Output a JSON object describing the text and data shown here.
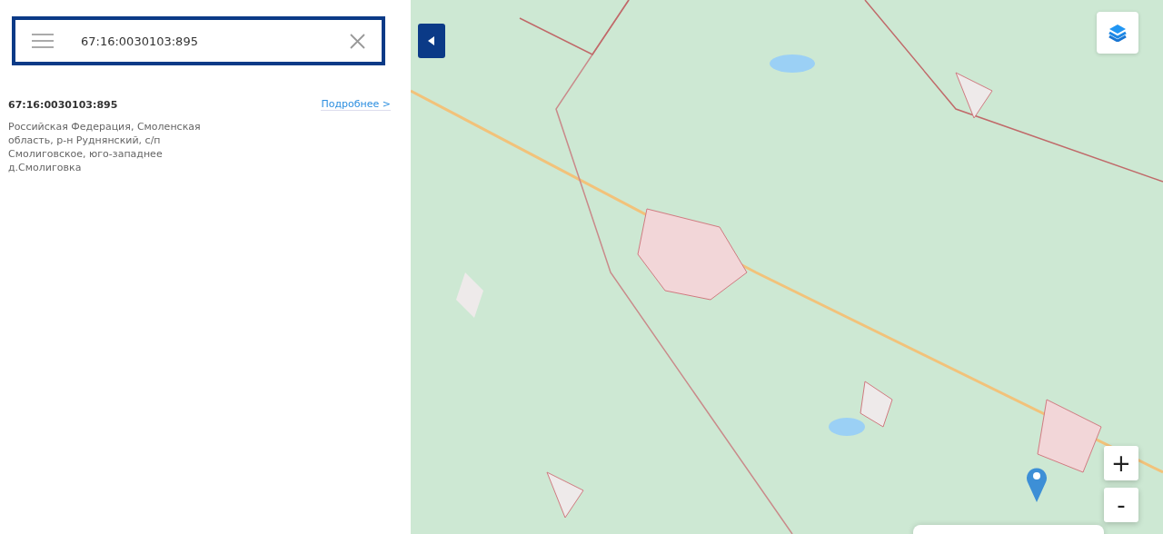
{
  "search": {
    "value": "67:16:0030103:895"
  },
  "result": {
    "title": "67:16:0030103:895",
    "link": "Подробнее >",
    "address": "Российская Федерация, Смоленская область, р-н Руднянский, с/п Смолиговское, юго-западнее д.Смолиговка"
  },
  "zoom_controls": [
    "+",
    "-"
  ]
}
